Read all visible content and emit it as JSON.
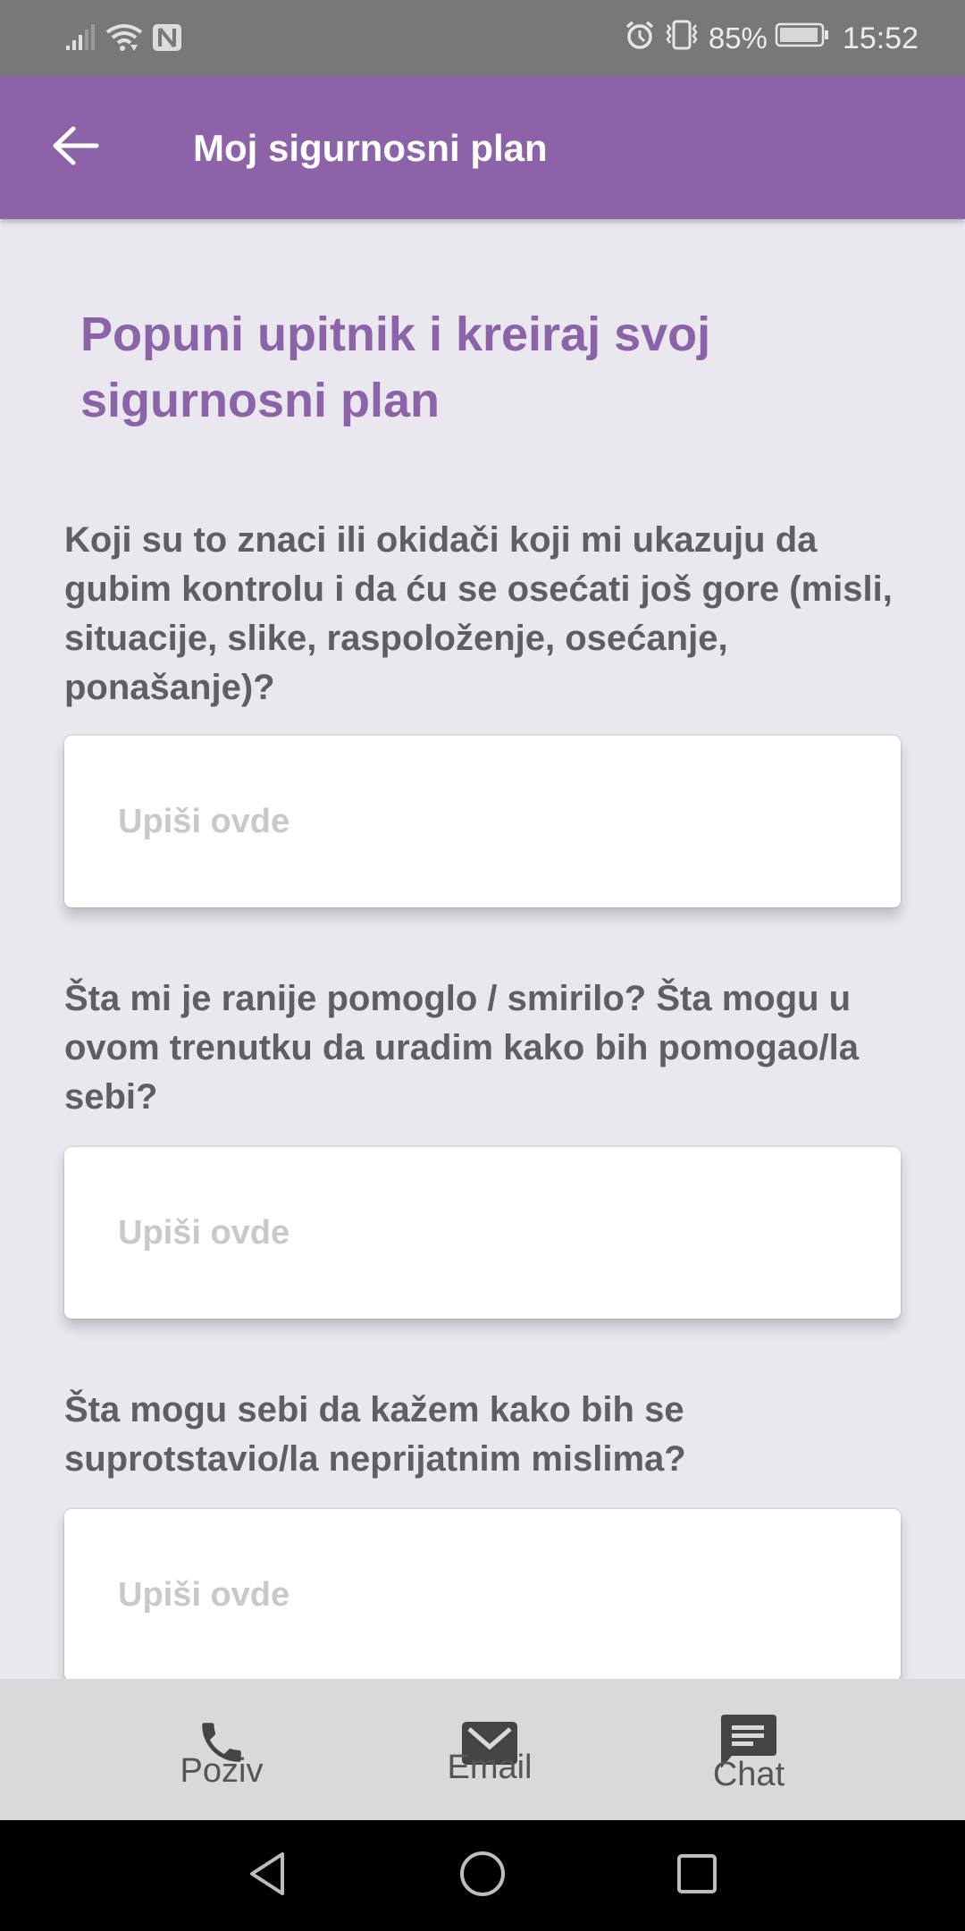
{
  "status_bar": {
    "battery_percent": "85%",
    "time": "15:52",
    "icons": [
      "signal-icon",
      "wifi-icon",
      "nfc-icon",
      "alarm-icon",
      "vibrate-icon",
      "battery-icon"
    ]
  },
  "app_bar": {
    "back_icon": "arrow-left-icon",
    "title": "Moj sigurnosni plan"
  },
  "colors": {
    "primary": "#8c62a8",
    "background": "#e9e8ee",
    "question_text": "#5f5e64",
    "placeholder": "#c9c9c9",
    "tab_bar": "#d9d9d9"
  },
  "main": {
    "heading": "Popuni upitnik i kreiraj svoj sigurnosni plan",
    "questions": [
      {
        "text": "Koji su to znaci ili okidači koji mi ukazuju da gubim kontrolu i da ću se osećati još gore (misli, situacije, slike, raspoloženje, osećanje, ponašanje)?",
        "placeholder": "Upiši ovde",
        "value": ""
      },
      {
        "text": "Šta mi je ranije pomoglo / smirilo? Šta mogu u ovom trenutku da uradim kako bih pomogao/la sebi?",
        "placeholder": "Upiši ovde",
        "value": ""
      },
      {
        "text": "Šta mogu sebi da kažem kako bih se suprotstavio/la neprijatnim mislima?",
        "placeholder": "Upiši ovde",
        "value": ""
      }
    ]
  },
  "tab_bar": {
    "items": [
      {
        "label": "Poziv",
        "icon": "phone-icon"
      },
      {
        "label": "Email",
        "icon": "email-icon"
      },
      {
        "label": "Chat",
        "icon": "chat-icon"
      }
    ]
  },
  "nav_bar": {
    "items": [
      "back-nav-icon",
      "home-nav-icon",
      "recents-nav-icon"
    ]
  }
}
